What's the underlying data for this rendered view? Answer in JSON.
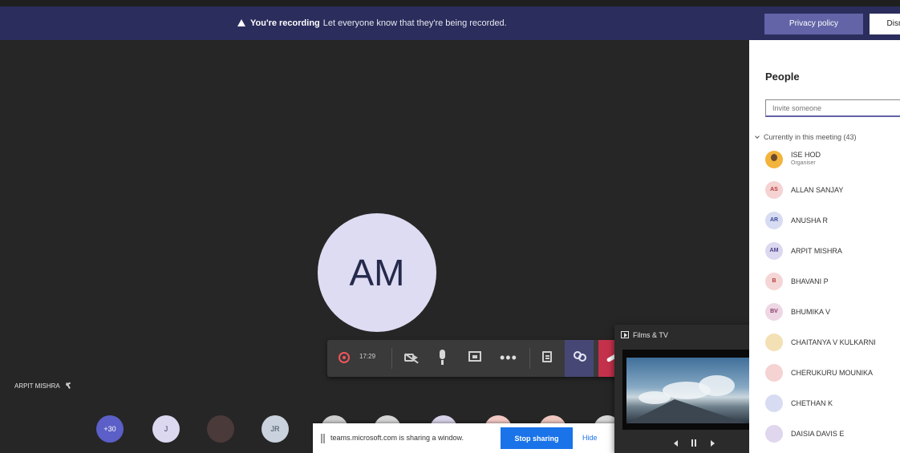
{
  "banner": {
    "title": "You're recording",
    "message": "Let everyone know that they're being recorded.",
    "privacy_label": "Privacy policy",
    "dismiss_label": "Dismiss"
  },
  "stage": {
    "main_initials": "AM",
    "presenter_name": "ARPIT MISHRA",
    "timer": "17:29"
  },
  "strip": {
    "overflow_count": "+30",
    "avatars": [
      {
        "initials": "J",
        "color": "#dcd8f0",
        "text_color": "#444466"
      },
      {
        "initials": "",
        "color": "#4a3a3a",
        "text_color": "#ffffff"
      },
      {
        "initials": "JR",
        "color": "#c9d2dd",
        "text_color": "#3b4a5c"
      },
      {
        "initials": "",
        "color": "#cfcfcf",
        "text_color": "#555555"
      },
      {
        "initials": "",
        "color": "#d6d6d6",
        "text_color": "#555555"
      },
      {
        "initials": "",
        "color": "#d9d3e9",
        "text_color": "#555555"
      },
      {
        "initials": "",
        "color": "#f2c9c4",
        "text_color": "#555555"
      },
      {
        "initials": "",
        "color": "#f0c7c0",
        "text_color": "#555555"
      },
      {
        "initials": "M",
        "color": "#d9d9d9",
        "text_color": "#444444"
      }
    ]
  },
  "sharebar": {
    "message": "teams.microsoft.com is sharing a window.",
    "stop_label": "Stop sharing",
    "hide_label": "Hide"
  },
  "mini_player": {
    "title": "Films & TV"
  },
  "panel": {
    "title": "People",
    "invite_placeholder": "Invite someone",
    "section": "Currently in this meeting (43)",
    "people": [
      {
        "name": "ISE HOD",
        "role": "Organiser",
        "initials": "",
        "bg": "#f2b43c",
        "fg": "#ffffff"
      },
      {
        "name": "ALLAN SANJAY",
        "role": "",
        "initials": "AS",
        "bg": "#f5d3d3",
        "fg": "#b53a3a"
      },
      {
        "name": "ANUSHA R",
        "role": "",
        "initials": "AR",
        "bg": "#d7dcf2",
        "fg": "#3a4a9a"
      },
      {
        "name": "ARPIT MISHRA",
        "role": "",
        "initials": "AM",
        "bg": "#dcd8f0",
        "fg": "#4a3f8a"
      },
      {
        "name": "BHAVANI P",
        "role": "",
        "initials": "B",
        "bg": "#f5d6d6",
        "fg": "#b53a3a"
      },
      {
        "name": "BHUMIKA V",
        "role": "",
        "initials": "BV",
        "bg": "#eed7e4",
        "fg": "#8a3a6a"
      },
      {
        "name": "CHAITANYA V KULKARNI",
        "role": "",
        "initials": "",
        "bg": "#f3e0b4",
        "fg": "#8a6a1a"
      },
      {
        "name": "CHERUKURU MOUNIKA",
        "role": "",
        "initials": "",
        "bg": "#f5d3d3",
        "fg": "#b53a3a"
      },
      {
        "name": "CHETHAN K",
        "role": "",
        "initials": "",
        "bg": "#d7dcf2",
        "fg": "#3a4a9a"
      },
      {
        "name": "DAISIA DAVIS E",
        "role": "",
        "initials": "",
        "bg": "#e0d6ee",
        "fg": "#5a3a8a"
      }
    ]
  }
}
